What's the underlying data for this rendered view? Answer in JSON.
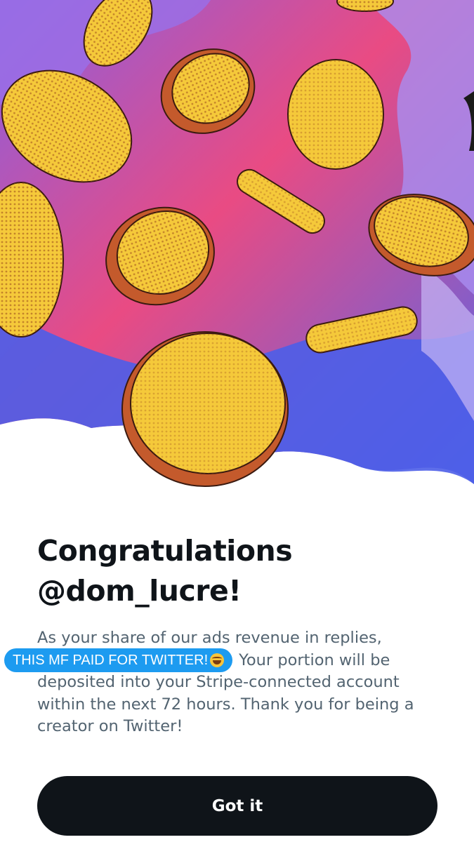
{
  "header": {
    "title_line1": "Congratulations",
    "title_line2": "@dom_lucre!"
  },
  "body": {
    "line1": "As your share of our ads revenue in replies,",
    "line2_rest": " Your portion will be",
    "line3": "deposited into your Stripe-connected account",
    "line4": "within the next 72 hours. Thank you for being a",
    "line5": "creator on Twitter!"
  },
  "overlay_caption": {
    "text": "THIS MF PAID FOR TWITTER!",
    "emoji": "face-with-tears-of-joy"
  },
  "actions": {
    "confirm_label": "Got it"
  },
  "hero": {
    "icon": "falling-gold-coins-illustration",
    "colors": {
      "pink": "#ec4a7c",
      "purple": "#8d63e0",
      "blue": "#4a5ce6",
      "coin": "#f5c93a",
      "coin_shadow": "#b8542a"
    }
  }
}
